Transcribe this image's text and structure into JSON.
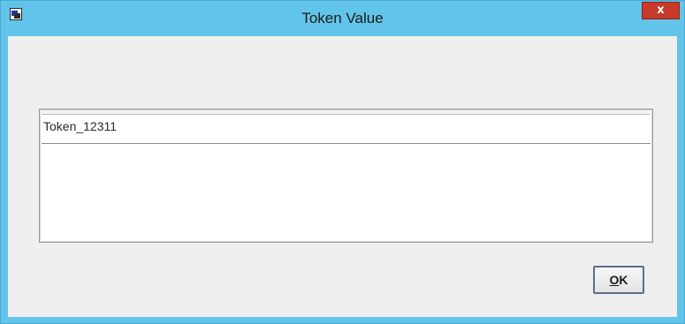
{
  "window": {
    "title": "Token Value",
    "close_label": "x"
  },
  "content": {
    "token_value": "Token_12311"
  },
  "buttons": {
    "ok_mnemonic": "O",
    "ok_rest": "K"
  },
  "colors": {
    "titlebar": "#62c4e8",
    "client_bg": "#efefef",
    "close_button": "#c7392a"
  }
}
